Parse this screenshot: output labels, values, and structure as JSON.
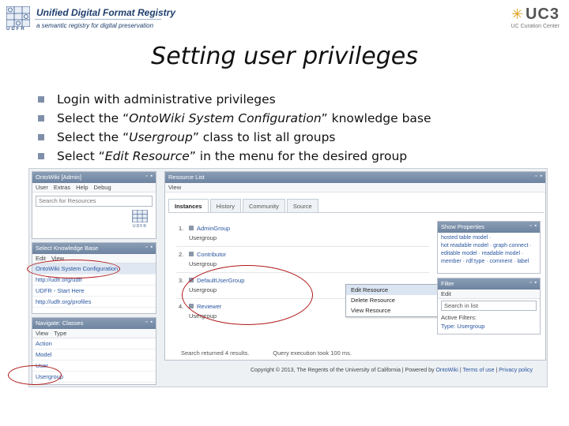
{
  "header": {
    "registry_title": "Unified Digital Format Registry",
    "registry_subtitle": "a semantic registry for digital preservation",
    "udfr_mark": "UDFR",
    "uc3_logo": "UC3",
    "uc3_subtitle": "UC Curation Center"
  },
  "slide": {
    "title": "Setting user privileges",
    "bullets": [
      {
        "before": "Login with administrative privileges",
        "em": "",
        "after": ""
      },
      {
        "before": "Select the “",
        "em": "OntoWiki System Configuration",
        "after": "” knowledge base"
      },
      {
        "before": "Select the “",
        "em": "Usergroup",
        "after": "” class to list all groups"
      },
      {
        "before": "Select “",
        "em": "Edit Resource",
        "after": "” in the menu for the desired group"
      }
    ]
  },
  "ontowiki": {
    "admin_window": {
      "title": "OntoWiki [Admin]",
      "menu": [
        "User",
        "Extras",
        "Help",
        "Debug"
      ],
      "search_placeholder": "Search for Resources",
      "logo_text": "UDFR"
    },
    "kb_window": {
      "title": "Select Knowledge Base",
      "menu": [
        "Edit",
        "View"
      ],
      "items": [
        "OntoWiki System Configuration",
        "http://udfr.org/udfr",
        "UDFR - Start Here",
        "http://udfr.org/profiles"
      ],
      "selected_index": 0
    },
    "classes_window": {
      "title": "Navigate: Classes",
      "menu": [
        "View",
        "Type"
      ],
      "items": [
        "Action",
        "Model",
        "User",
        "Usergroup"
      ]
    },
    "resource_window": {
      "title": "Resource List",
      "menu": [
        "View"
      ],
      "tabs": [
        "Instances",
        "History",
        "Community",
        "Source"
      ],
      "active_tab": 0,
      "items": [
        {
          "num": "1.",
          "name": "AdminGroup",
          "cls": "Usergroup"
        },
        {
          "num": "2.",
          "name": "Contributor",
          "cls": "Usergroup"
        },
        {
          "num": "3.",
          "name": "DefaultUserGroup",
          "cls": "Usergroup"
        },
        {
          "num": "4.",
          "name": "Reviewer",
          "cls": "Usergroup"
        }
      ],
      "context_menu": [
        "Edit Resource",
        "Delete Resource",
        "View Resource"
      ],
      "context_highlight": 0,
      "footer_left": "Search returned 4 results.",
      "footer_right": "Query execution took 100 ms."
    },
    "properties_window": {
      "title": "Show Properties",
      "lines": [
        "hosted table model ·",
        "hot readable model · graph connect ·",
        "editable model · readable model ·",
        "member · rdf:type · comment · label"
      ]
    },
    "filter_window": {
      "title": "Filter",
      "menu": [
        "Edit"
      ],
      "search_placeholder": "Search in list",
      "active_label": "Active Filters:",
      "active_value": "Type: Usergroup"
    },
    "copyright": {
      "text": "Copyright © 2013, The Regents of the University of California | Powered by ",
      "link1": "OntoWiki",
      "sep1": " | ",
      "link2": "Terms of use",
      "sep2": " | ",
      "link3": "Privacy policy"
    }
  },
  "colors": {
    "annotation": "#b01818",
    "title_bar": "#6d83a0",
    "link": "#2a56a0",
    "bullet": "#7f8fa9",
    "uc3_star": "#e0a21c"
  }
}
